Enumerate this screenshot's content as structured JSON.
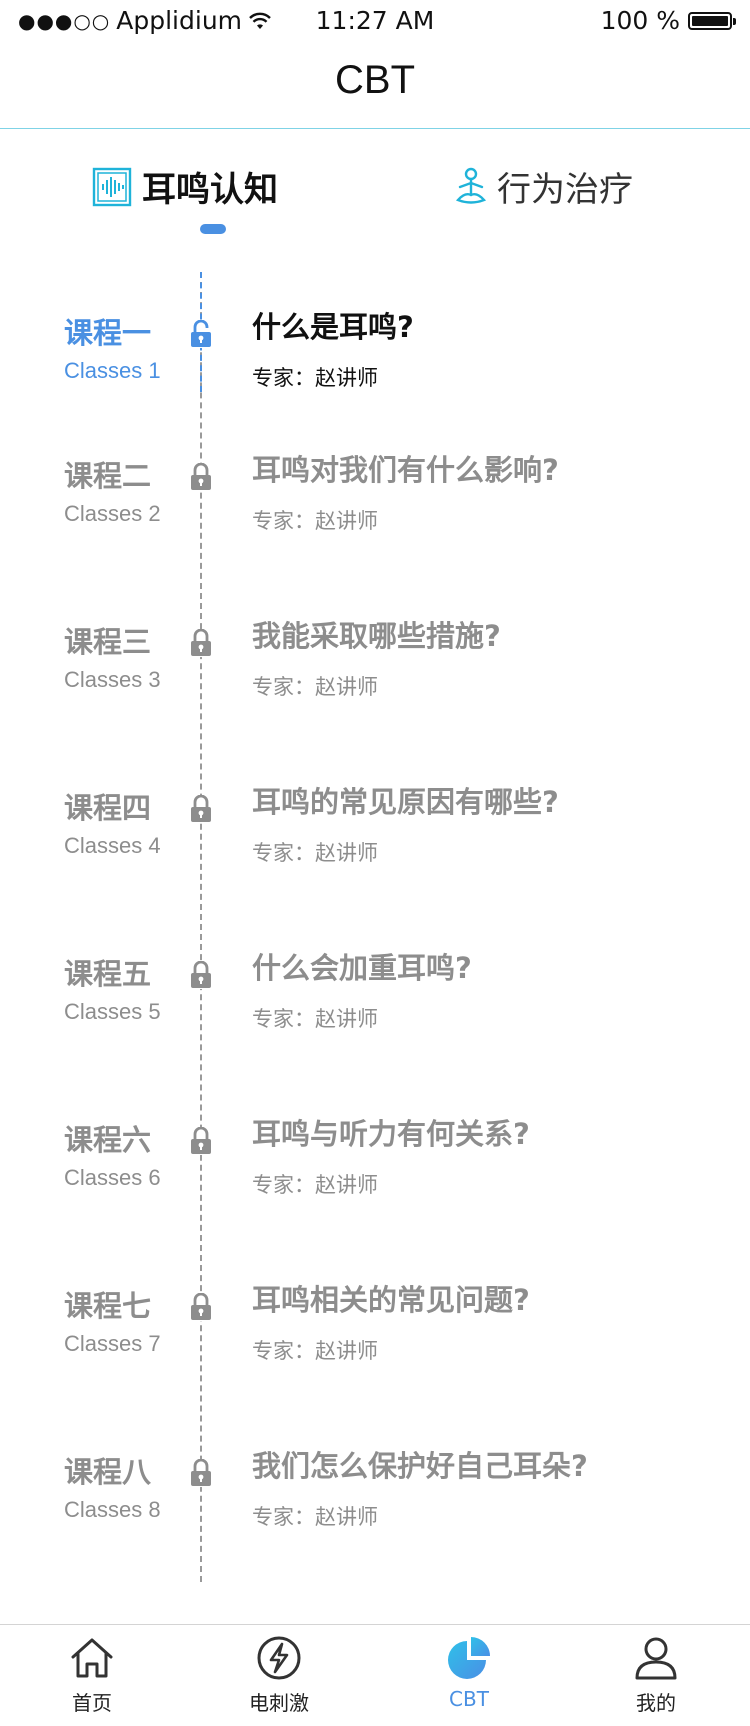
{
  "status_bar": {
    "carrier": "Applidium",
    "time": "11:27 AM",
    "battery": "100 %"
  },
  "nav": {
    "title": "CBT"
  },
  "tabs": [
    {
      "label": "耳鸣认知",
      "icon": "soundwave-icon",
      "active": true
    },
    {
      "label": "行为治疗",
      "icon": "meditation-icon",
      "active": false
    }
  ],
  "courses": [
    {
      "name": "课程一",
      "en": "Classes 1",
      "title": "什么是耳鸣?",
      "expert": "专家：赵讲师",
      "active": true
    },
    {
      "name": "课程二",
      "en": "Classes 2",
      "title": "耳鸣对我们有什么影响?",
      "expert": "专家：赵讲师",
      "active": false
    },
    {
      "name": "课程三",
      "en": "Classes 3",
      "title": "我能采取哪些措施?",
      "expert": "专家：赵讲师",
      "active": false
    },
    {
      "name": "课程四",
      "en": "Classes 4",
      "title": "耳鸣的常见原因有哪些?",
      "expert": "专家：赵讲师",
      "active": false
    },
    {
      "name": "课程五",
      "en": "Classes 5",
      "title": "什么会加重耳鸣?",
      "expert": "专家：赵讲师",
      "active": false
    },
    {
      "name": "课程六",
      "en": "Classes 6",
      "title": "耳鸣与听力有何关系?",
      "expert": "专家：赵讲师",
      "active": false
    },
    {
      "name": "课程七",
      "en": "Classes 7",
      "title": "耳鸣相关的常见问题?",
      "expert": "专家：赵讲师",
      "active": false
    },
    {
      "name": "课程八",
      "en": "Classes 8",
      "title": "我们怎么保护好自己耳朵?",
      "expert": "专家：赵讲师",
      "active": false
    }
  ],
  "tab_bar": [
    {
      "label": "首页",
      "icon": "home-icon",
      "active": false
    },
    {
      "label": "电刺激",
      "icon": "lightning-icon",
      "active": false
    },
    {
      "label": "CBT",
      "icon": "pie-chart-icon",
      "active": true
    },
    {
      "label": "我的",
      "icon": "user-icon",
      "active": false
    }
  ],
  "colors": {
    "accent": "#4a90e2",
    "teal": "#1fb3d9",
    "muted": "#8d8d8d",
    "divider": "#7fd3e6"
  }
}
